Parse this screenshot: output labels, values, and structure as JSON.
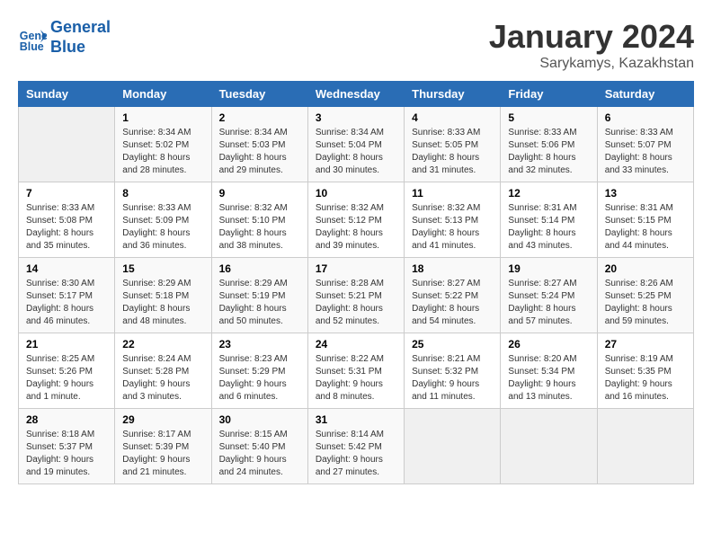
{
  "header": {
    "logo_line1": "General",
    "logo_line2": "Blue",
    "month": "January 2024",
    "location": "Sarykamys, Kazakhstan"
  },
  "weekdays": [
    "Sunday",
    "Monday",
    "Tuesday",
    "Wednesday",
    "Thursday",
    "Friday",
    "Saturday"
  ],
  "weeks": [
    [
      {
        "day": "",
        "sunrise": "",
        "sunset": "",
        "daylight": ""
      },
      {
        "day": "1",
        "sunrise": "Sunrise: 8:34 AM",
        "sunset": "Sunset: 5:02 PM",
        "daylight": "Daylight: 8 hours and 28 minutes."
      },
      {
        "day": "2",
        "sunrise": "Sunrise: 8:34 AM",
        "sunset": "Sunset: 5:03 PM",
        "daylight": "Daylight: 8 hours and 29 minutes."
      },
      {
        "day": "3",
        "sunrise": "Sunrise: 8:34 AM",
        "sunset": "Sunset: 5:04 PM",
        "daylight": "Daylight: 8 hours and 30 minutes."
      },
      {
        "day": "4",
        "sunrise": "Sunrise: 8:33 AM",
        "sunset": "Sunset: 5:05 PM",
        "daylight": "Daylight: 8 hours and 31 minutes."
      },
      {
        "day": "5",
        "sunrise": "Sunrise: 8:33 AM",
        "sunset": "Sunset: 5:06 PM",
        "daylight": "Daylight: 8 hours and 32 minutes."
      },
      {
        "day": "6",
        "sunrise": "Sunrise: 8:33 AM",
        "sunset": "Sunset: 5:07 PM",
        "daylight": "Daylight: 8 hours and 33 minutes."
      }
    ],
    [
      {
        "day": "7",
        "sunrise": "Sunrise: 8:33 AM",
        "sunset": "Sunset: 5:08 PM",
        "daylight": "Daylight: 8 hours and 35 minutes."
      },
      {
        "day": "8",
        "sunrise": "Sunrise: 8:33 AM",
        "sunset": "Sunset: 5:09 PM",
        "daylight": "Daylight: 8 hours and 36 minutes."
      },
      {
        "day": "9",
        "sunrise": "Sunrise: 8:32 AM",
        "sunset": "Sunset: 5:10 PM",
        "daylight": "Daylight: 8 hours and 38 minutes."
      },
      {
        "day": "10",
        "sunrise": "Sunrise: 8:32 AM",
        "sunset": "Sunset: 5:12 PM",
        "daylight": "Daylight: 8 hours and 39 minutes."
      },
      {
        "day": "11",
        "sunrise": "Sunrise: 8:32 AM",
        "sunset": "Sunset: 5:13 PM",
        "daylight": "Daylight: 8 hours and 41 minutes."
      },
      {
        "day": "12",
        "sunrise": "Sunrise: 8:31 AM",
        "sunset": "Sunset: 5:14 PM",
        "daylight": "Daylight: 8 hours and 43 minutes."
      },
      {
        "day": "13",
        "sunrise": "Sunrise: 8:31 AM",
        "sunset": "Sunset: 5:15 PM",
        "daylight": "Daylight: 8 hours and 44 minutes."
      }
    ],
    [
      {
        "day": "14",
        "sunrise": "Sunrise: 8:30 AM",
        "sunset": "Sunset: 5:17 PM",
        "daylight": "Daylight: 8 hours and 46 minutes."
      },
      {
        "day": "15",
        "sunrise": "Sunrise: 8:29 AM",
        "sunset": "Sunset: 5:18 PM",
        "daylight": "Daylight: 8 hours and 48 minutes."
      },
      {
        "day": "16",
        "sunrise": "Sunrise: 8:29 AM",
        "sunset": "Sunset: 5:19 PM",
        "daylight": "Daylight: 8 hours and 50 minutes."
      },
      {
        "day": "17",
        "sunrise": "Sunrise: 8:28 AM",
        "sunset": "Sunset: 5:21 PM",
        "daylight": "Daylight: 8 hours and 52 minutes."
      },
      {
        "day": "18",
        "sunrise": "Sunrise: 8:27 AM",
        "sunset": "Sunset: 5:22 PM",
        "daylight": "Daylight: 8 hours and 54 minutes."
      },
      {
        "day": "19",
        "sunrise": "Sunrise: 8:27 AM",
        "sunset": "Sunset: 5:24 PM",
        "daylight": "Daylight: 8 hours and 57 minutes."
      },
      {
        "day": "20",
        "sunrise": "Sunrise: 8:26 AM",
        "sunset": "Sunset: 5:25 PM",
        "daylight": "Daylight: 8 hours and 59 minutes."
      }
    ],
    [
      {
        "day": "21",
        "sunrise": "Sunrise: 8:25 AM",
        "sunset": "Sunset: 5:26 PM",
        "daylight": "Daylight: 9 hours and 1 minute."
      },
      {
        "day": "22",
        "sunrise": "Sunrise: 8:24 AM",
        "sunset": "Sunset: 5:28 PM",
        "daylight": "Daylight: 9 hours and 3 minutes."
      },
      {
        "day": "23",
        "sunrise": "Sunrise: 8:23 AM",
        "sunset": "Sunset: 5:29 PM",
        "daylight": "Daylight: 9 hours and 6 minutes."
      },
      {
        "day": "24",
        "sunrise": "Sunrise: 8:22 AM",
        "sunset": "Sunset: 5:31 PM",
        "daylight": "Daylight: 9 hours and 8 minutes."
      },
      {
        "day": "25",
        "sunrise": "Sunrise: 8:21 AM",
        "sunset": "Sunset: 5:32 PM",
        "daylight": "Daylight: 9 hours and 11 minutes."
      },
      {
        "day": "26",
        "sunrise": "Sunrise: 8:20 AM",
        "sunset": "Sunset: 5:34 PM",
        "daylight": "Daylight: 9 hours and 13 minutes."
      },
      {
        "day": "27",
        "sunrise": "Sunrise: 8:19 AM",
        "sunset": "Sunset: 5:35 PM",
        "daylight": "Daylight: 9 hours and 16 minutes."
      }
    ],
    [
      {
        "day": "28",
        "sunrise": "Sunrise: 8:18 AM",
        "sunset": "Sunset: 5:37 PM",
        "daylight": "Daylight: 9 hours and 19 minutes."
      },
      {
        "day": "29",
        "sunrise": "Sunrise: 8:17 AM",
        "sunset": "Sunset: 5:39 PM",
        "daylight": "Daylight: 9 hours and 21 minutes."
      },
      {
        "day": "30",
        "sunrise": "Sunrise: 8:15 AM",
        "sunset": "Sunset: 5:40 PM",
        "daylight": "Daylight: 9 hours and 24 minutes."
      },
      {
        "day": "31",
        "sunrise": "Sunrise: 8:14 AM",
        "sunset": "Sunset: 5:42 PM",
        "daylight": "Daylight: 9 hours and 27 minutes."
      },
      {
        "day": "",
        "sunrise": "",
        "sunset": "",
        "daylight": ""
      },
      {
        "day": "",
        "sunrise": "",
        "sunset": "",
        "daylight": ""
      },
      {
        "day": "",
        "sunrise": "",
        "sunset": "",
        "daylight": ""
      }
    ]
  ]
}
